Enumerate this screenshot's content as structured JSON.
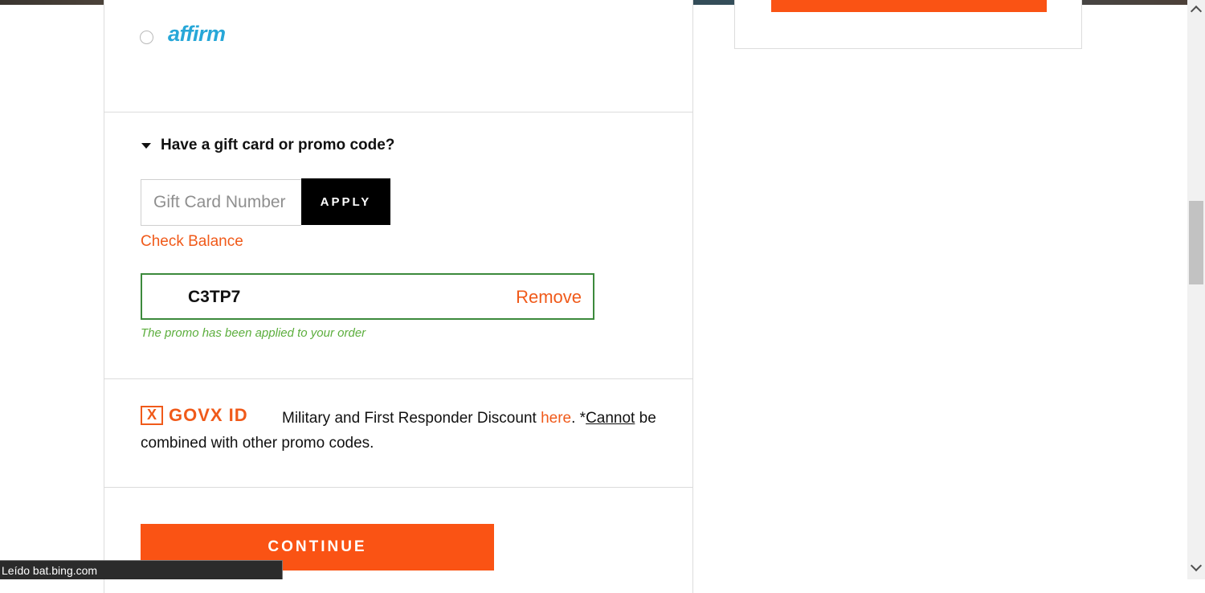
{
  "payment": {
    "affirm_label": "affirm"
  },
  "gift": {
    "toggle_label": "Have a gift card or promo code?",
    "input_placeholder": "Gift Card Number",
    "input_value": "",
    "apply_label": "APPLY",
    "check_balance_label": "Check Balance"
  },
  "promo": {
    "code": "C3TP7",
    "remove_label": "Remove",
    "applied_message": "The promo has been applied to your order"
  },
  "govx": {
    "logo_mark": "X",
    "logo_text": "GOVX ID",
    "text_before": "Military and First Responder Discount ",
    "link_here": "here",
    "text_after": ". *",
    "cannot": "Cannot",
    "text_end": " be combined with other promo codes."
  },
  "continue_label": "CONTINUE",
  "status_bar_text": "Leído bat.bing.com",
  "colors": {
    "accent_orange": "#fa5314",
    "link_orange": "#f05a1a",
    "success_green": "#5cae3d",
    "promo_border_green": "#3c8a3c",
    "affirm_blue": "#27a7d8"
  },
  "icons": [
    "radio-icon",
    "caret-down-icon",
    "govx-logo-icon",
    "chevron-up-icon",
    "chevron-down-icon"
  ]
}
